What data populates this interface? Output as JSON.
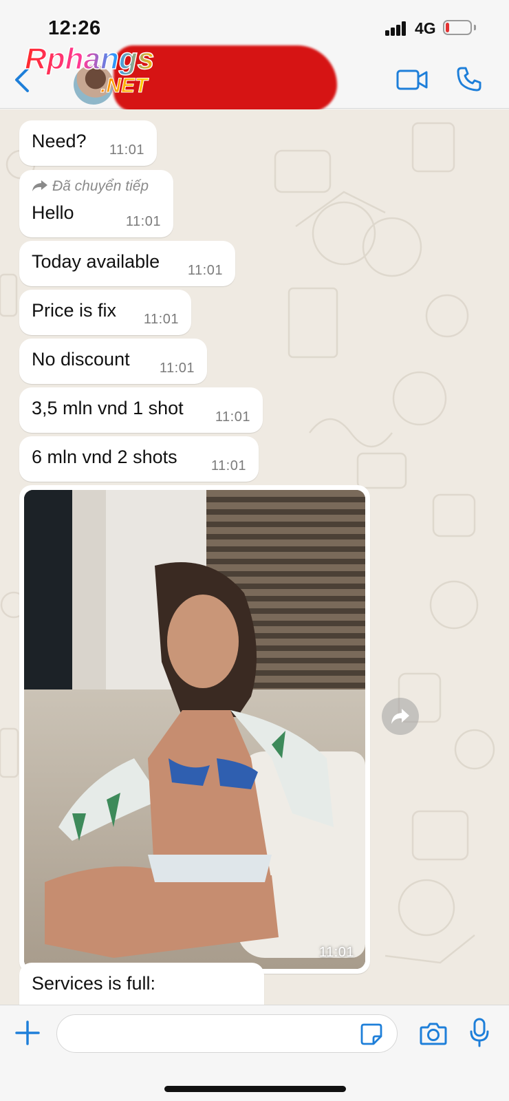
{
  "status_bar": {
    "time": "12:26",
    "network": "4G",
    "battery_level": 0.15
  },
  "header": {
    "watermark_line1": "Rphangs",
    "watermark_line2": ".NET",
    "contact_name_redacted": true
  },
  "messages": [
    {
      "text": "Need?",
      "time": "11:01",
      "forwarded": false
    },
    {
      "text": "Hello",
      "time": "11:01",
      "forwarded": true,
      "forwarded_label": "Đã chuyển tiếp"
    },
    {
      "text": "Today available",
      "time": "11:01",
      "forwarded": false
    },
    {
      "text": "Price is fix",
      "time": "11:01",
      "forwarded": false
    },
    {
      "text": "No discount",
      "time": "11:01",
      "forwarded": false
    },
    {
      "text": "3,5 mln vnd 1 shot",
      "time": "11:01",
      "forwarded": false
    },
    {
      "text": "6 mln vnd 2 shots",
      "time": "11:01",
      "forwarded": false
    }
  ],
  "photo_message": {
    "time": "11:01"
  },
  "partial_message": {
    "text": "Services is full:"
  },
  "input": {
    "placeholder": "",
    "value": ""
  },
  "colors": {
    "accent": "#1e7fd9",
    "bubble": "#ffffff",
    "chat_background": "#efeae2",
    "redaction": "#d50d0d"
  },
  "icons": {
    "back": "chevron-left-icon",
    "video": "video-camera-icon",
    "call": "phone-icon",
    "forward": "forward-arrow-icon",
    "plus": "plus-icon",
    "sticker": "sticker-icon",
    "camera": "camera-icon",
    "mic": "microphone-icon"
  }
}
